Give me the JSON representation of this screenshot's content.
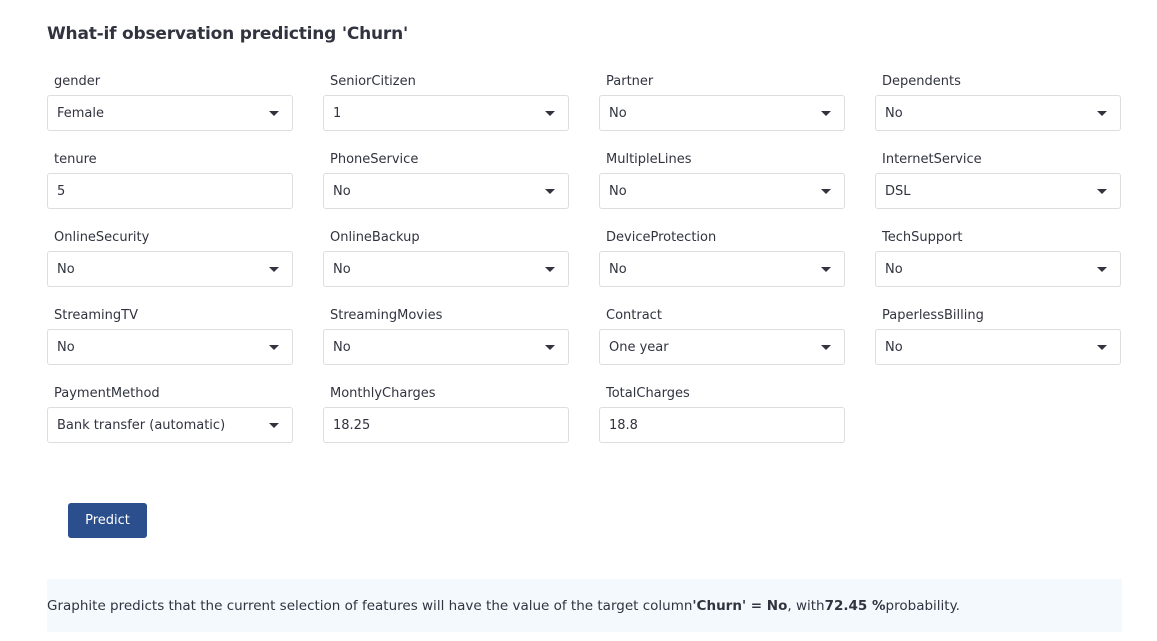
{
  "heading": "What-if observation predicting 'Churn'",
  "fields": [
    {
      "label": "gender",
      "type": "select",
      "value": "Female"
    },
    {
      "label": "SeniorCitizen",
      "type": "select",
      "value": "1"
    },
    {
      "label": "Partner",
      "type": "select",
      "value": "No"
    },
    {
      "label": "Dependents",
      "type": "select",
      "value": "No"
    },
    {
      "label": "tenure",
      "type": "input",
      "value": "5"
    },
    {
      "label": "PhoneService",
      "type": "select",
      "value": "No"
    },
    {
      "label": "MultipleLines",
      "type": "select",
      "value": "No"
    },
    {
      "label": "InternetService",
      "type": "select",
      "value": "DSL"
    },
    {
      "label": "OnlineSecurity",
      "type": "select",
      "value": "No"
    },
    {
      "label": "OnlineBackup",
      "type": "select",
      "value": "No"
    },
    {
      "label": "DeviceProtection",
      "type": "select",
      "value": "No"
    },
    {
      "label": "TechSupport",
      "type": "select",
      "value": "No"
    },
    {
      "label": "StreamingTV",
      "type": "select",
      "value": "No"
    },
    {
      "label": "StreamingMovies",
      "type": "select",
      "value": "No"
    },
    {
      "label": "Contract",
      "type": "select",
      "value": "One year"
    },
    {
      "label": "PaperlessBilling",
      "type": "select",
      "value": "No"
    },
    {
      "label": "PaymentMethod",
      "type": "select",
      "value": "Bank transfer (automatic)"
    },
    {
      "label": "MonthlyCharges",
      "type": "input",
      "value": "18.25"
    },
    {
      "label": "TotalCharges",
      "type": "input",
      "value": "18.8"
    }
  ],
  "predict_label": "Predict",
  "result": {
    "prefix": "Graphite predicts that the current selection of features will have the value of the target column ",
    "target_expr": "'Churn' = No",
    "middle": ", with ",
    "probability": "72.45 %",
    "suffix": " probability."
  }
}
